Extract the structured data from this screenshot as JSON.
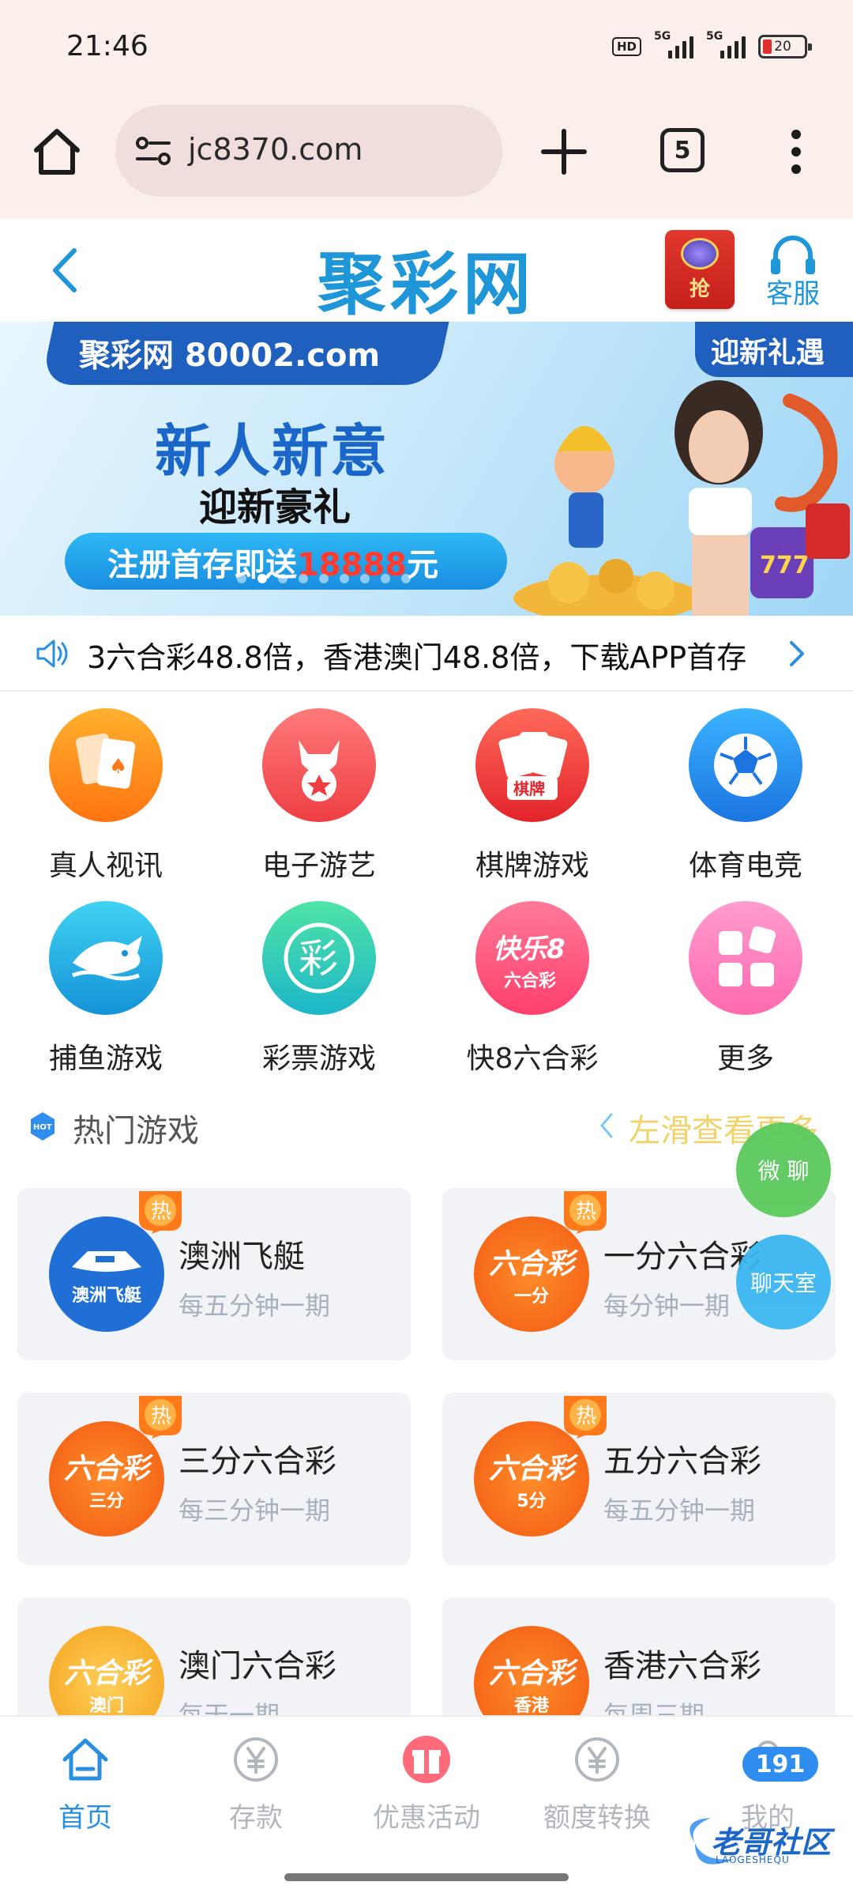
{
  "status_bar": {
    "time": "21:46",
    "hd_label": "HD",
    "net1": "5G",
    "net2": "5G",
    "battery": "20"
  },
  "browser": {
    "url": "jc8370.com",
    "tab_count": "5"
  },
  "header": {
    "title": "聚彩网",
    "redpacket_label": "抢",
    "customer_service_label": "客服"
  },
  "banner": {
    "domain": "聚彩网 80002.com",
    "tag": "迎新礼遇",
    "headline": "新人新意",
    "subheadline": "迎新豪礼",
    "cta_prefix": "注册首存即送",
    "cta_amount": "18888",
    "cta_suffix": "元"
  },
  "marquee": {
    "text": "3六合彩48.8倍，香港澳门48.8倍，下载APP首存"
  },
  "categories": [
    {
      "label": "真人视讯",
      "icon": "playing-cards-icon",
      "color": "#ff8a1c"
    },
    {
      "label": "电子游艺",
      "icon": "devil-mask-icon",
      "color": "#ff5a5a"
    },
    {
      "label": "棋牌游戏",
      "icon": "poker-cards-icon",
      "color": "#ff4747"
    },
    {
      "label": "体育电竞",
      "icon": "soccer-ball-icon",
      "color": "#2f8df0"
    },
    {
      "label": "捕鱼游戏",
      "icon": "shark-icon",
      "color": "#24a9e6"
    },
    {
      "label": "彩票游戏",
      "icon": "lottery-cai-icon",
      "color": "#2ec9b8"
    },
    {
      "label": "快8六合彩",
      "icon": "kuaile8-icon",
      "color": "#ff5b7a",
      "logo_top": "快乐8",
      "logo_bottom": "六合彩"
    },
    {
      "label": "更多",
      "icon": "more-grid-icon",
      "color": "#ff7eb8"
    }
  ],
  "hot": {
    "title": "热门游戏",
    "hint": "左滑查看更多",
    "hot_badge": "HOT",
    "card_badge": "热"
  },
  "games": [
    {
      "name": "澳洲飞艇",
      "desc": "每五分钟一期",
      "logo_a": "",
      "logo_b": "澳洲飞艇",
      "color": "#1f6fd6",
      "hot": true
    },
    {
      "name": "一分六合彩",
      "desc": "每分钟一期",
      "logo_a": "六合彩",
      "logo_b": "一分",
      "color": "#ff6a1a",
      "hot": true
    },
    {
      "name": "三分六合彩",
      "desc": "每三分钟一期",
      "logo_a": "六合彩",
      "logo_b": "三分",
      "color": "#ff6a1a",
      "hot": true
    },
    {
      "name": "五分六合彩",
      "desc": "每五分钟一期",
      "logo_a": "六合彩",
      "logo_b": "5分",
      "color": "#ff6a1a",
      "hot": true
    },
    {
      "name": "澳门六合彩",
      "desc": "每天一期",
      "logo_a": "六合彩",
      "logo_b": "澳门",
      "color": "#f9b234",
      "hot": false
    },
    {
      "name": "香港六合彩",
      "desc": "每周三期",
      "logo_a": "六合彩",
      "logo_b": "香港",
      "color": "#ff6a1a",
      "hot": false
    }
  ],
  "floating": {
    "weiliao": "微 聊",
    "chat": "聊天室"
  },
  "bottom_nav": [
    {
      "label": "首页",
      "icon": "home-icon",
      "active": true
    },
    {
      "label": "存款",
      "icon": "yen-coin-icon",
      "active": false
    },
    {
      "label": "优惠活动",
      "icon": "gift-icon",
      "active": false
    },
    {
      "label": "额度转换",
      "icon": "yen-exchange-icon",
      "active": false
    },
    {
      "label": "我的",
      "icon": "user-icon",
      "active": false
    }
  ],
  "nav_badge": "191",
  "watermark": {
    "text": "老哥社区",
    "sub": "LAOGESHEQU"
  }
}
